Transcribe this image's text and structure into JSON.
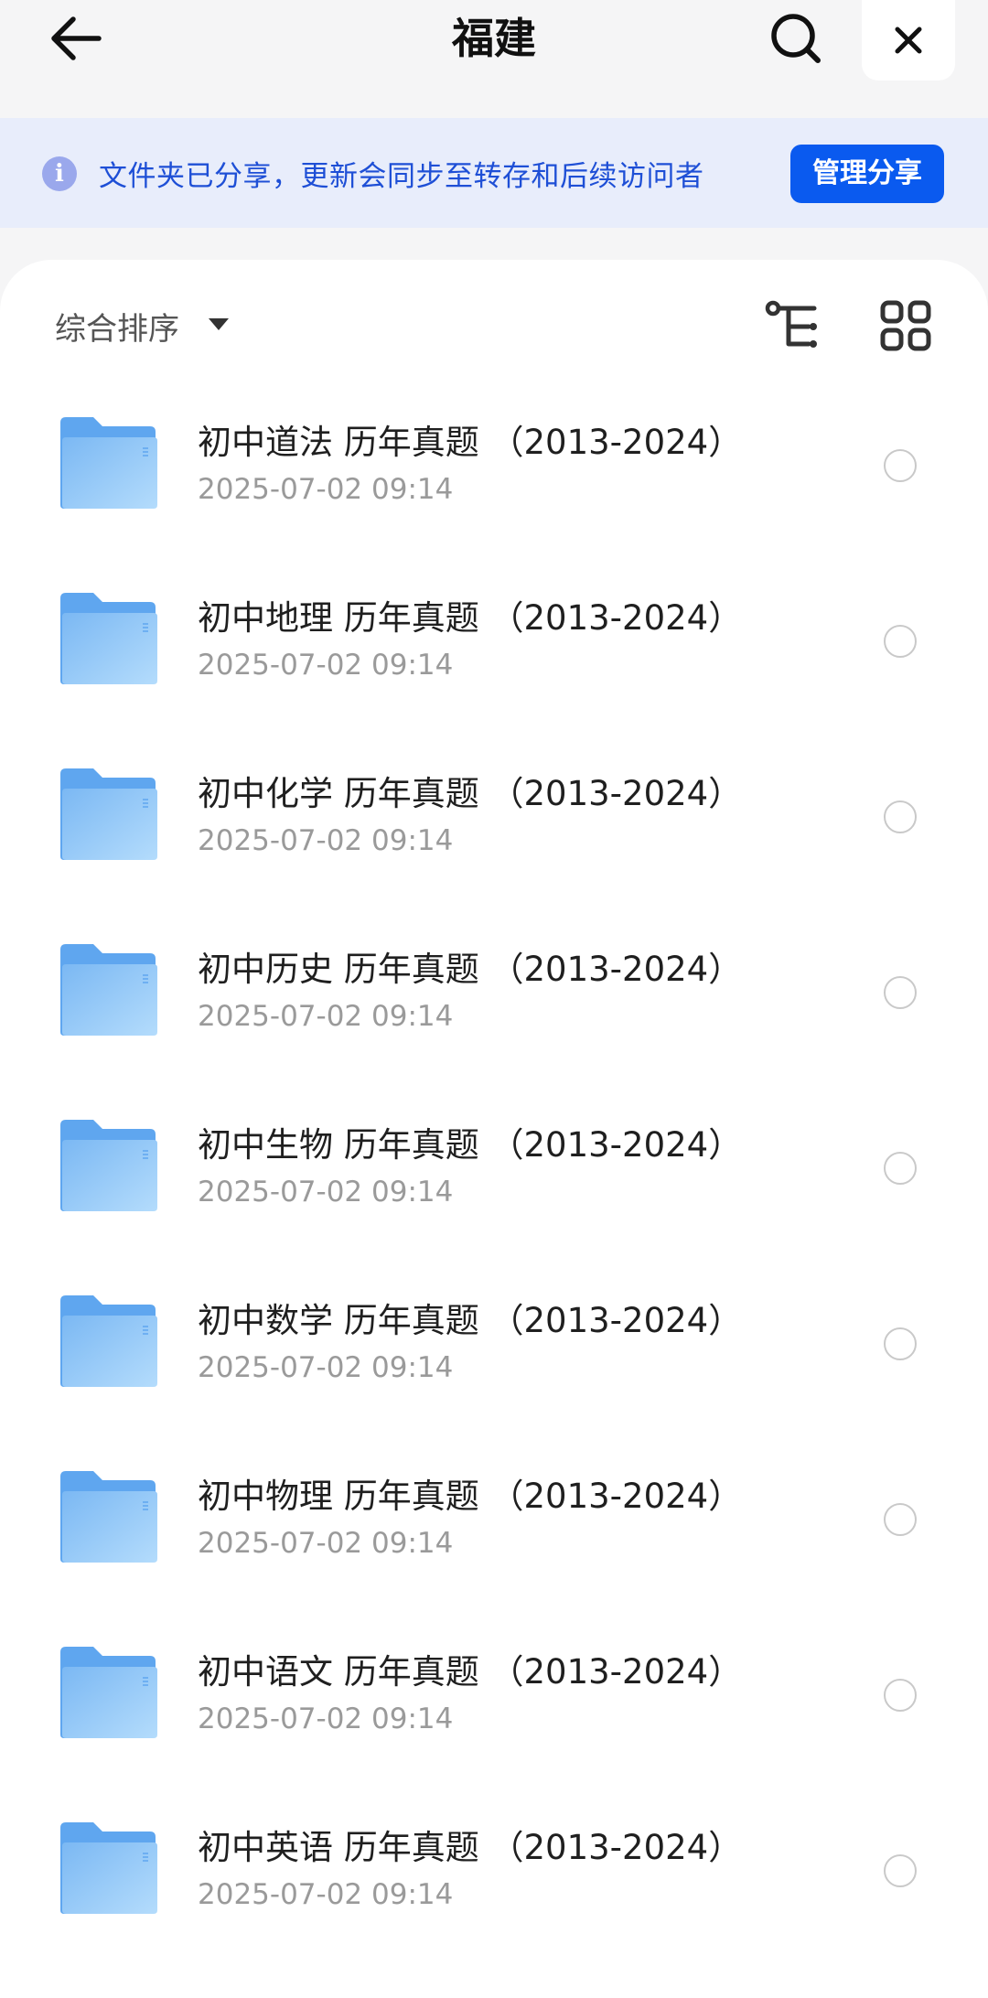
{
  "header": {
    "title": "福建"
  },
  "banner": {
    "info_glyph": "i",
    "text": "文件夹已分享，更新会同步至转存和后续访问者",
    "manage_label": "管理分享"
  },
  "toolbar": {
    "sort_label": "综合排序"
  },
  "folders": [
    {
      "title": "初中道法 历年真题 （2013-2024）",
      "date": "2025-07-02 09:14"
    },
    {
      "title": "初中地理 历年真题 （2013-2024）",
      "date": "2025-07-02 09:14"
    },
    {
      "title": "初中化学 历年真题 （2013-2024）",
      "date": "2025-07-02 09:14"
    },
    {
      "title": "初中历史 历年真题 （2013-2024）",
      "date": "2025-07-02 09:14"
    },
    {
      "title": "初中生物 历年真题 （2013-2024）",
      "date": "2025-07-02 09:14"
    },
    {
      "title": "初中数学 历年真题 （2013-2024）",
      "date": "2025-07-02 09:14"
    },
    {
      "title": "初中物理 历年真题 （2013-2024）",
      "date": "2025-07-02 09:14"
    },
    {
      "title": "初中语文 历年真题 （2013-2024）",
      "date": "2025-07-02 09:14"
    },
    {
      "title": "初中英语 历年真题 （2013-2024）",
      "date": "2025-07-02 09:14"
    }
  ],
  "colors": {
    "accent": "#0a5aef",
    "banner_bg": "#e8edfb",
    "banner_text": "#1e4fd6",
    "folder_light": "#a9d4fb",
    "folder_dark": "#5fa6ef"
  },
  "icons": {
    "back": "arrow-left-icon",
    "search": "search-icon",
    "close": "close-icon",
    "info": "info-icon",
    "sort": "caret-down-icon",
    "tree": "tree-view-icon",
    "grid": "grid-view-icon",
    "folder": "folder-icon",
    "select": "radio-circle-icon"
  }
}
